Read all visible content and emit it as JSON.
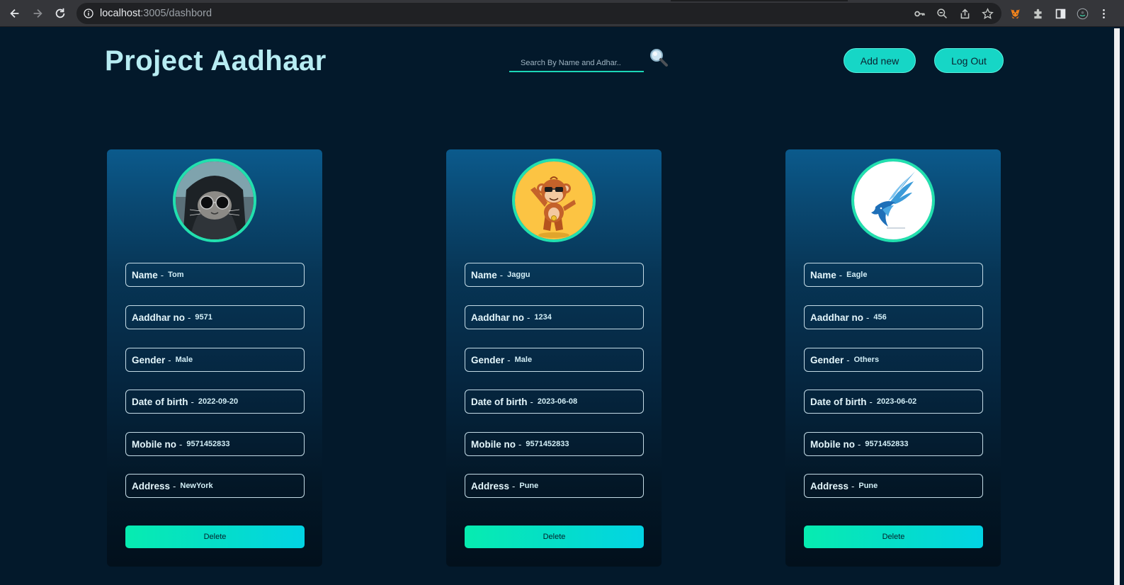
{
  "browser": {
    "url_host": "localhost",
    "url_path": ":3005/dashbord"
  },
  "header": {
    "title": "Project Aadhaar",
    "search_placeholder": "Search By Name and Adhar..",
    "add_label": "Add new",
    "logout_label": "Log Out"
  },
  "labels": {
    "name": "Name",
    "aadhar": "Aaddhar no",
    "gender": "Gender",
    "dob": "Date of birth",
    "mobile": "Mobile no",
    "address": "Address",
    "separator": "-",
    "delete": "Delete"
  },
  "cards": [
    {
      "name": "Tom",
      "aadhar": "9571",
      "gender": "Male",
      "dob": "2022-09-20",
      "mobile": "9571452833",
      "address": "NewYork",
      "avatar": "cat-with-sunglasses"
    },
    {
      "name": "Jaggu",
      "aadhar": "1234",
      "gender": "Male",
      "dob": "2023-06-08",
      "mobile": "9571452833",
      "address": "Pune",
      "avatar": "dabbing-monkey"
    },
    {
      "name": "Eagle",
      "aadhar": "456",
      "gender": "Others",
      "dob": "2023-06-02",
      "mobile": "9571452833",
      "address": "Pune",
      "avatar": "blue-eagle-logo"
    }
  ],
  "colors": {
    "background": "#03192b",
    "accent": "#16d6c6",
    "avatar_border": "#22e0ae",
    "title": "#b7ecf2"
  }
}
